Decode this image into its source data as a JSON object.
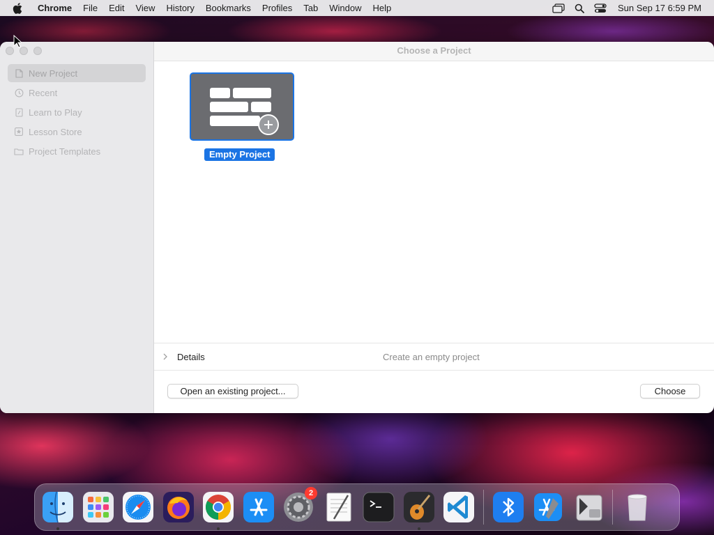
{
  "menubar": {
    "app_name": "Chrome",
    "items": [
      "File",
      "Edit",
      "View",
      "History",
      "Bookmarks",
      "Profiles",
      "Tab",
      "Window",
      "Help"
    ],
    "clock": "Sun Sep 17  6:59 PM",
    "status_icons": [
      "screen-mirroring-icon",
      "search-icon",
      "control-center-icon"
    ]
  },
  "window": {
    "title": "Choose a Project",
    "sidebar": {
      "items": [
        {
          "label": "New Project",
          "icon": "document-icon",
          "selected": true
        },
        {
          "label": "Recent",
          "icon": "clock-icon"
        },
        {
          "label": "Learn to Play",
          "icon": "book-icon"
        },
        {
          "label": "Lesson Store",
          "icon": "star-icon"
        },
        {
          "label": "Project Templates",
          "icon": "folder-icon"
        }
      ]
    },
    "project": {
      "label": "Empty Project",
      "icon": "add-icon"
    },
    "details": {
      "label": "Details",
      "description": "Create an empty project"
    },
    "buttons": {
      "open": "Open an existing project...",
      "choose": "Choose"
    }
  },
  "dock": {
    "apps": [
      {
        "name": "Finder",
        "running": true
      },
      {
        "name": "Launchpad"
      },
      {
        "name": "Safari"
      },
      {
        "name": "Firefox"
      },
      {
        "name": "Chrome",
        "running": true
      },
      {
        "name": "App Store"
      },
      {
        "name": "System Preferences",
        "badge": "2"
      },
      {
        "name": "TextEdit"
      },
      {
        "name": "Terminal"
      },
      {
        "name": "GarageBand",
        "running": true
      },
      {
        "name": "Visual Studio Code"
      },
      {
        "name": "Bluetooth"
      },
      {
        "name": "Xcode"
      },
      {
        "name": "Boot Camp Assistant"
      },
      {
        "name": "Trash"
      }
    ]
  },
  "colors": {
    "accent": "#1b74e4",
    "badge": "#ff3b30"
  }
}
